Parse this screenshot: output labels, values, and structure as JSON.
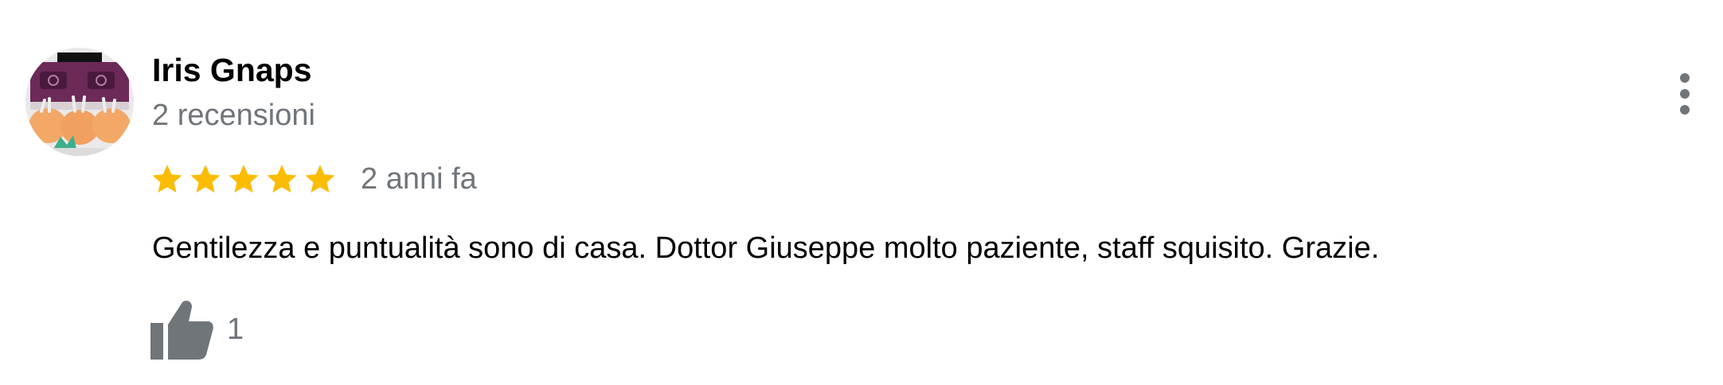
{
  "review": {
    "reviewer_name": "Iris Gnaps",
    "review_count_text": "2 recensioni",
    "rating": 5,
    "rating_max": 5,
    "date_text": "2 anni fa",
    "text": "Gentilezza e puntualità sono di casa. Dottor Giuseppe molto paziente, staff squisito. Grazie.",
    "like_count": "1"
  },
  "icons": {
    "star": "star-icon",
    "like": "thumbs-up-icon",
    "more": "more-vertical-icon"
  },
  "colors": {
    "star": "#fbbc04",
    "secondary_text": "#70757a",
    "primary_text": "#000000",
    "icon_gray": "#70757a"
  }
}
